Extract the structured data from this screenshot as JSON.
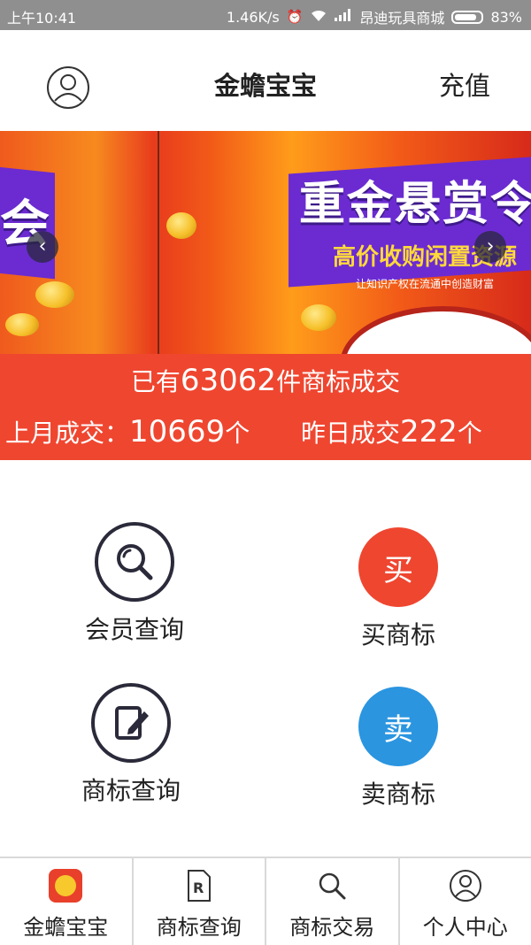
{
  "status_bar": {
    "time": "上午10:41",
    "speed": "1.46K/s",
    "carrier": "昂迪玩具商城",
    "battery": "83%",
    "battery_level": 0.83
  },
  "header": {
    "title": "金蟾宝宝",
    "recharge_label": "充值"
  },
  "banner": {
    "left_text": "会",
    "headline": "重金悬赏令",
    "subline": "高价收购闲置资源",
    "tagline": "让知识产权在流通中创造财富"
  },
  "stats": {
    "total_prefix": "已有",
    "total_count": "63062",
    "total_suffix": "件商标成交",
    "last_month_label": "上月成交：",
    "last_month_count": "10669",
    "last_month_unit": "个",
    "yesterday_label": "昨日成交",
    "yesterday_count": "222",
    "yesterday_unit": "个"
  },
  "features": {
    "member_query": "会员查询",
    "buy_trademark": "买商标",
    "buy_glyph": "买",
    "trademark_query": "商标查询",
    "sell_trademark": "卖商标",
    "sell_glyph": "卖"
  },
  "tabbar": {
    "items": [
      {
        "label": "金蟾宝宝",
        "icon": "app-logo-icon"
      },
      {
        "label": "商标查询",
        "icon": "registered-doc-icon"
      },
      {
        "label": "商标交易",
        "icon": "search-icon"
      },
      {
        "label": "个人中心",
        "icon": "user-icon"
      }
    ]
  },
  "colors": {
    "accent_red": "#ef4630",
    "accent_blue": "#2b95e0",
    "banner_purple": "#6b2bd1"
  }
}
